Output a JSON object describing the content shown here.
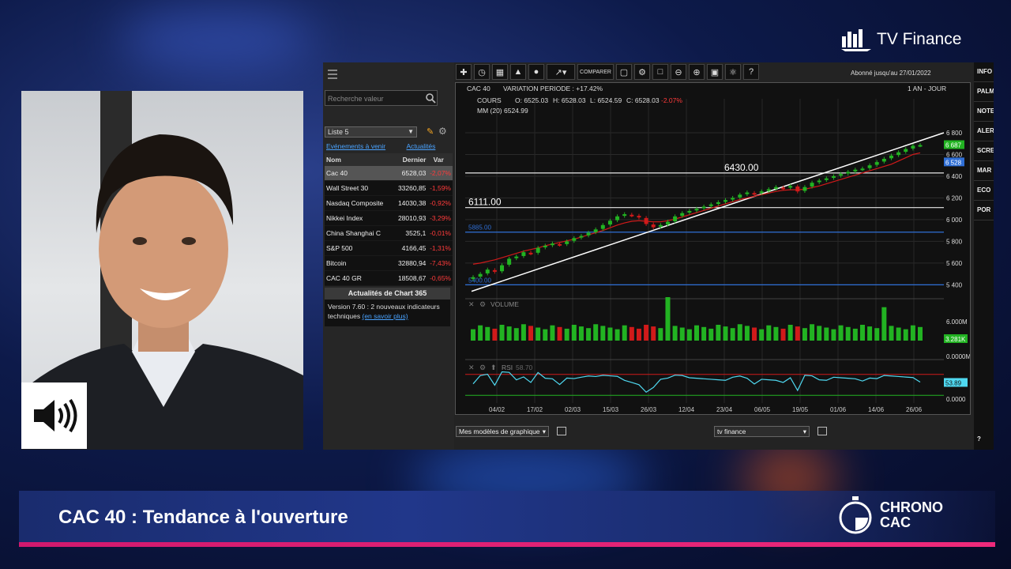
{
  "brand": {
    "name": "TV Finance"
  },
  "banner": {
    "title": "CAC 40 : Tendance à l'ouverture",
    "logo_line1": "CHRONO",
    "logo_line2": "CAC"
  },
  "sidebar": {
    "search_placeholder": "Recherche valeur",
    "list_selected": "Liste 5",
    "link_events": "Evénements à venir",
    "link_news": "Actualités",
    "table_headers": {
      "name": "Nom",
      "last": "Dernier",
      "var": "Var"
    },
    "rows": [
      {
        "name": "Cac 40",
        "last": "6528,03",
        "var": "-2,07%"
      },
      {
        "name": "Wall Street 30",
        "last": "33260,85",
        "var": "-1,59%"
      },
      {
        "name": "Nasdaq Composite",
        "last": "14030,38",
        "var": "-0,92%"
      },
      {
        "name": "Nikkei Index",
        "last": "28010,93",
        "var": "-3,29%"
      },
      {
        "name": "China Shanghai C",
        "last": "3525,1",
        "var": "-0,01%"
      },
      {
        "name": "S&P 500",
        "last": "4166,45",
        "var": "-1,31%"
      },
      {
        "name": "Bitcoin",
        "last": "32880,94",
        "var": "-7,43%"
      },
      {
        "name": "CAC 40 GR",
        "last": "18508,67",
        "var": "-0,65%"
      }
    ],
    "news_title": "Actualités de Chart 365",
    "news_body": "Version 7.60 : 2 nouveaux indicateurs techniques",
    "news_link": "(en savoir plus)"
  },
  "toolbar": {
    "compare_label": "COMPARER",
    "help_label": "?",
    "subscription": "Abonné jusqu'au 27/01/2022"
  },
  "chart_header": {
    "symbol": "CAC 40",
    "variation": "VARIATION PERIODE : +17.42%",
    "period": "1 AN - JOUR",
    "cours_label": "COURS",
    "open": "O: 6525.03",
    "high": "H: 6528.03",
    "low": "L: 6524.59",
    "close": "C: 6528.03",
    "change": "-2.07%",
    "ma_label": "MM (20) 6524.99",
    "volume_label": "VOLUME",
    "rsi_label": "RSI",
    "rsi_value": "58.70"
  },
  "chart_data": {
    "type": "candlestick",
    "x_ticks": [
      "04/02",
      "17/02",
      "02/03",
      "15/03",
      "26/03",
      "12/04",
      "23/04",
      "06/05",
      "19/05",
      "01/06",
      "14/06",
      "26/06"
    ],
    "y_ticks": [
      5400,
      5600,
      5800,
      6000,
      6200,
      6400,
      6600,
      6800
    ],
    "ylim": [
      5330,
      6880
    ],
    "last_price_label": "6 528",
    "upper_label": "6 687",
    "hlines": [
      {
        "label": "6430.00",
        "value": 6430
      },
      {
        "label": "6111.00",
        "value": 6111
      },
      {
        "label": "5885.00",
        "value": 5885
      },
      {
        "label": "5400.00",
        "value": 5400
      }
    ],
    "close_series": [
      5470,
      5500,
      5540,
      5520,
      5580,
      5640,
      5660,
      5700,
      5690,
      5740,
      5760,
      5780,
      5770,
      5800,
      5830,
      5850,
      5880,
      5910,
      5950,
      5990,
      6030,
      6050,
      6040,
      6020,
      5960,
      5930,
      5950,
      5980,
      6030,
      6060,
      6080,
      6100,
      6120,
      6140,
      6160,
      6180,
      6200,
      6230,
      6250,
      6240,
      6260,
      6280,
      6300,
      6290,
      6310,
      6260,
      6300,
      6340,
      6360,
      6380,
      6400,
      6420,
      6440,
      6460,
      6470,
      6500,
      6530,
      6560,
      6590,
      6620,
      6650,
      6680,
      6687
    ],
    "ma_series": [
      5590,
      5600,
      5615,
      5630,
      5650,
      5670,
      5690,
      5710,
      5725,
      5740,
      5760,
      5775,
      5790,
      5805,
      5820,
      5840,
      5860,
      5880,
      5900,
      5925,
      5950,
      5970,
      5985,
      5990,
      5985,
      5980,
      5980,
      5990,
      6005,
      6025,
      6045,
      6065,
      6085,
      6105,
      6125,
      6145,
      6165,
      6185,
      6200,
      6215,
      6230,
      6245,
      6260,
      6270,
      6275,
      6275,
      6280,
      6295,
      6310,
      6330,
      6350,
      6370,
      6390,
      6410,
      6430,
      6450,
      6470,
      6490,
      6510,
      6540,
      6570,
      6600,
      6615
    ],
    "volume": {
      "labels": [
        "6.000M",
        "0.0000M"
      ],
      "last_label": "3.281K",
      "spikes": [
        {
          "index": 27,
          "value": 6.5
        },
        {
          "index": 57,
          "value": 5.0
        }
      ]
    },
    "rsi": {
      "labels": [
        "53.89",
        "0.0000"
      ],
      "last_label": "53.89",
      "upper_band": 70,
      "lower_band": 30
    }
  },
  "bottom": {
    "templates_select": "Mes modèles de graphique",
    "layout_select": "tv finance"
  },
  "right_nav": [
    "INFO",
    "PALM",
    "NOTE",
    "ALER",
    "SCRE",
    "MAR",
    "ECO",
    "POR"
  ],
  "right_nav_bottom": "?",
  "colors": {
    "accent_pink": "#ee2a7b",
    "banner_blue": "#21378a",
    "up": "#22b322",
    "down": "#d11a1a"
  }
}
